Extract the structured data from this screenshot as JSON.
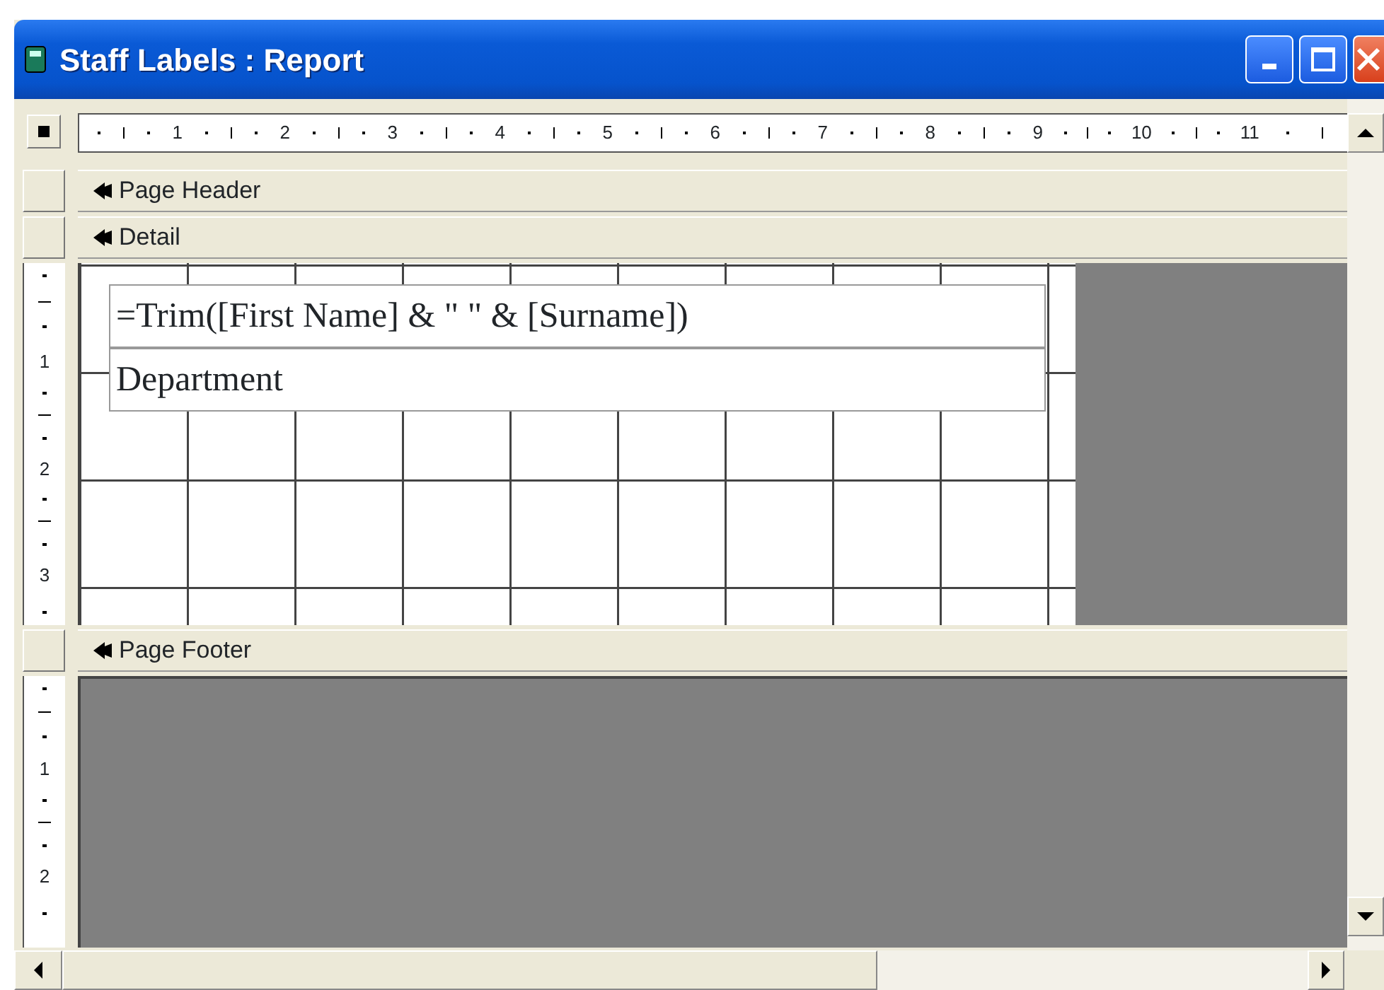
{
  "window": {
    "title": "Staff Labels : Report"
  },
  "horizontal_ruler": {
    "labels": [
      "1",
      "2",
      "3",
      "4",
      "5",
      "6",
      "7",
      "8",
      "9",
      "10",
      "11"
    ]
  },
  "sections": [
    {
      "label": "Page Header",
      "kind": "empty"
    },
    {
      "label": "Detail",
      "kind": "detail",
      "vertical_ruler": [
        "1",
        "2",
        "3"
      ],
      "controls": [
        {
          "text": "=Trim([First Name] & \" \" & [Surname])"
        },
        {
          "text": "Department"
        }
      ]
    },
    {
      "label": "Page Footer",
      "kind": "footer",
      "vertical_ruler": [
        "1",
        "2"
      ]
    }
  ]
}
